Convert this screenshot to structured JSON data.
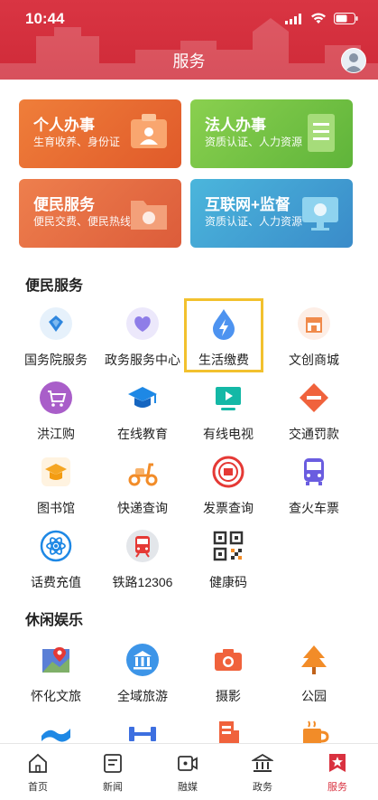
{
  "status_bar": {
    "time": "10:44"
  },
  "header": {
    "title": "服务"
  },
  "cards": [
    {
      "title": "个人办事",
      "subtitle": "生育收养、身份证",
      "color": "#e7672f"
    },
    {
      "title": "法人办事",
      "subtitle": "资质认证、人力资源",
      "color": "#7ac043"
    },
    {
      "title": "便民服务",
      "subtitle": "便民交费、便民热线",
      "color": "#e4703e"
    },
    {
      "title": "互联网+监督",
      "subtitle": "资质认证、人力资源",
      "color": "#3e9fd2"
    }
  ],
  "sections": {
    "convenience": {
      "title": "便民服务",
      "items": [
        {
          "label": "国务院服务",
          "icon": "state-council-icon"
        },
        {
          "label": "政务服务中心",
          "icon": "gov-center-icon"
        },
        {
          "label": "生活缴费",
          "icon": "utility-payment-icon",
          "highlighted": true
        },
        {
          "label": "文创商城",
          "icon": "store-icon"
        },
        {
          "label": "洪江购",
          "icon": "shopping-cart-icon"
        },
        {
          "label": "在线教育",
          "icon": "graduation-cap-icon"
        },
        {
          "label": "有线电视",
          "icon": "tv-icon"
        },
        {
          "label": "交通罚款",
          "icon": "traffic-fine-icon"
        },
        {
          "label": "图书馆",
          "icon": "library-icon"
        },
        {
          "label": "快递查询",
          "icon": "scooter-icon"
        },
        {
          "label": "发票查询",
          "icon": "invoice-seal-icon"
        },
        {
          "label": "查火车票",
          "icon": "bus-icon"
        },
        {
          "label": "话费充值",
          "icon": "atom-icon"
        },
        {
          "label": "铁路12306",
          "icon": "train-icon"
        },
        {
          "label": "健康码",
          "icon": "qr-code-icon"
        }
      ]
    },
    "leisure": {
      "title": "休闲娱乐",
      "items": [
        {
          "label": "怀化文旅",
          "icon": "map-pin-icon"
        },
        {
          "label": "全域旅游",
          "icon": "museum-icon"
        },
        {
          "label": "摄影",
          "icon": "camera-icon"
        },
        {
          "label": "公园",
          "icon": "tree-icon"
        },
        {
          "label": "",
          "icon": "wave-icon"
        },
        {
          "label": "",
          "icon": "dumbbell-icon"
        },
        {
          "label": "",
          "icon": "building-icon"
        },
        {
          "label": "",
          "icon": "coffee-icon"
        }
      ]
    }
  },
  "tabbar": [
    {
      "label": "首页",
      "icon": "home-icon"
    },
    {
      "label": "新闻",
      "icon": "news-icon"
    },
    {
      "label": "融媒",
      "icon": "media-icon"
    },
    {
      "label": "政务",
      "icon": "government-icon"
    },
    {
      "label": "服务",
      "icon": "service-icon",
      "active": true
    }
  ],
  "colors": {
    "brand_red": "#d9313f",
    "highlight": "#f2c12e"
  }
}
